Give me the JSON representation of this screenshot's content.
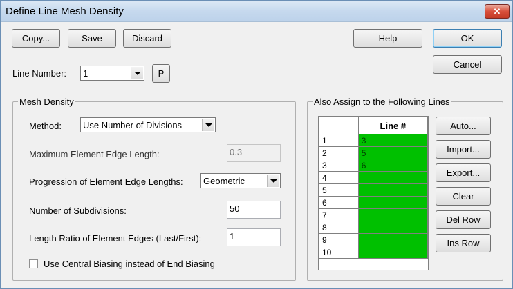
{
  "window": {
    "title": "Define Line Mesh Density",
    "close_label": "✕"
  },
  "toolbar": {
    "copy": "Copy...",
    "save": "Save",
    "discard": "Discard",
    "help": "Help",
    "ok": "OK",
    "cancel": "Cancel"
  },
  "line_number": {
    "label": "Line Number:",
    "value": "1",
    "p_button": "P"
  },
  "mesh_density": {
    "group_title": "Mesh Density",
    "method_label": "Method:",
    "method_value": "Use Number of Divisions",
    "max_edge_label": "Maximum Element Edge Length:",
    "max_edge_value": "0.3",
    "progression_label": "Progression of Element Edge Lengths:",
    "progression_value": "Geometric",
    "subdivisions_label": "Number of Subdivisions:",
    "subdivisions_value": "50",
    "ratio_label": "Length Ratio of Element Edges (Last/First):",
    "ratio_value": "1",
    "central_biasing_label": "Use Central Biasing instead of End Biasing",
    "central_biasing_checked": false
  },
  "also_assign": {
    "group_title": "Also Assign to the Following Lines",
    "column_header": "Line #",
    "rows": [
      {
        "num": "1",
        "value": "3"
      },
      {
        "num": "2",
        "value": "5"
      },
      {
        "num": "3",
        "value": "6"
      },
      {
        "num": "4",
        "value": ""
      },
      {
        "num": "5",
        "value": ""
      },
      {
        "num": "6",
        "value": ""
      },
      {
        "num": "7",
        "value": ""
      },
      {
        "num": "8",
        "value": ""
      },
      {
        "num": "9",
        "value": ""
      },
      {
        "num": "10",
        "value": ""
      }
    ],
    "buttons": {
      "auto": "Auto...",
      "import": "Import...",
      "export": "Export...",
      "clear": "Clear",
      "del_row": "Del Row",
      "ins_row": "Ins Row"
    }
  },
  "colors": {
    "cell_fill": "#00c000"
  }
}
